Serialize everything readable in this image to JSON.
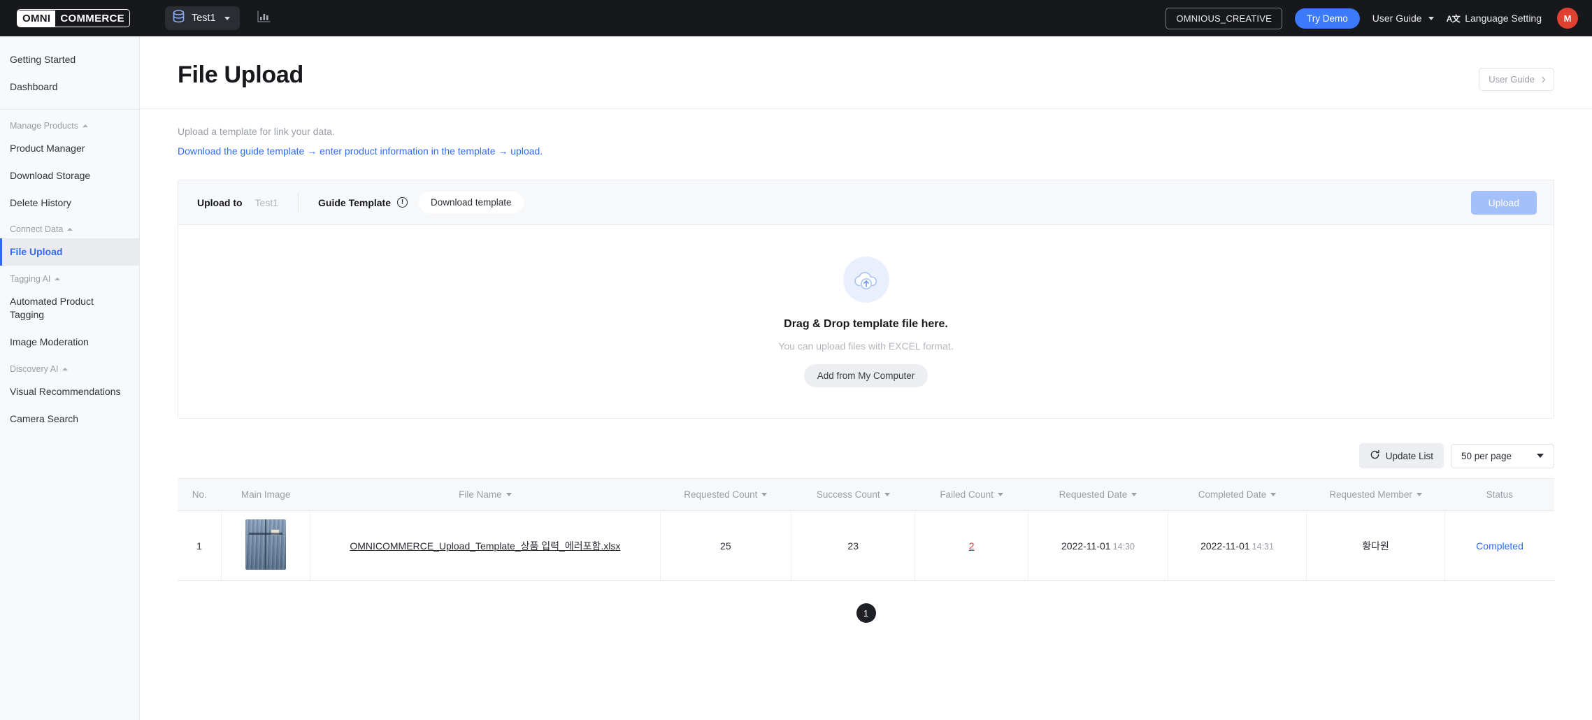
{
  "topbar": {
    "logo_left": "OMNI",
    "logo_right": "COMMERCE",
    "project_name": "Test1",
    "db_icon": "database-icon",
    "chart_icon": "bar-chart-icon",
    "org_name": "OMNIOUS_CREATIVE",
    "try_demo": "Try Demo",
    "user_guide": "User Guide",
    "language_glyph": "A文",
    "language_setting": "Language Setting",
    "avatar_initial": "M",
    "accent_blue": "#3b7bfb",
    "avatar_color": "#e0402f"
  },
  "sidebar": {
    "top_items": [
      {
        "label": "Getting Started"
      },
      {
        "label": "Dashboard"
      }
    ],
    "groups": [
      {
        "label": "Manage Products",
        "items": [
          {
            "label": "Product Manager",
            "active": false
          },
          {
            "label": "Download Storage",
            "active": false
          },
          {
            "label": "Delete History",
            "active": false
          }
        ]
      },
      {
        "label": "Connect Data",
        "items": [
          {
            "label": "File Upload",
            "active": true
          }
        ]
      },
      {
        "label": "Tagging AI",
        "items": [
          {
            "label": "Automated Product Tagging",
            "active": false
          },
          {
            "label": "Image Moderation",
            "active": false
          }
        ]
      },
      {
        "label": "Discovery AI",
        "items": [
          {
            "label": "Visual Recommendations",
            "active": false
          },
          {
            "label": "Camera Search",
            "active": false
          }
        ]
      }
    ]
  },
  "page": {
    "title": "File Upload",
    "user_guide_button": "User Guide",
    "description": "Upload a template for link your data.",
    "description_link": "Download the guide template → enter product information in the template → upload."
  },
  "upload_card": {
    "upload_to_label": "Upload to",
    "upload_to_value": "Test1",
    "guide_template_label": "Guide Template",
    "info_icon": "info-circle-icon",
    "download_template": "Download template",
    "upload_button": "Upload",
    "upload_button_disabled": true,
    "dropzone_icon": "cloud-upload-icon",
    "dropzone_title": "Drag & Drop template file here.",
    "dropzone_subtitle": "You can upload files with EXCEL format.",
    "dropzone_button": "Add from My Computer"
  },
  "table_controls": {
    "update_list": "Update List",
    "refresh_icon": "refresh-icon",
    "per_page": "50 per page"
  },
  "table": {
    "columns": [
      {
        "label": "No.",
        "sortable": false
      },
      {
        "label": "Main Image",
        "sortable": false
      },
      {
        "label": "File Name",
        "sortable": true
      },
      {
        "label": "Requested Count",
        "sortable": true
      },
      {
        "label": "Success Count",
        "sortable": true
      },
      {
        "label": "Failed Count",
        "sortable": true
      },
      {
        "label": "Requested Date",
        "sortable": true
      },
      {
        "label": "Completed Date",
        "sortable": true
      },
      {
        "label": "Requested Member",
        "sortable": true
      },
      {
        "label": "Status",
        "sortable": false
      }
    ],
    "rows": [
      {
        "no": "1",
        "image_alt": "denim-jacket-thumbnail",
        "file_name": "OMNICOMMERCE_Upload_Template_상품 입력_에러포함.xlsx",
        "requested_count": "25",
        "success_count": "23",
        "failed_count": "2",
        "requested_date": "2022-11-01",
        "requested_time": "14:30",
        "completed_date": "2022-11-01",
        "completed_time": "14:31",
        "requested_member": "황다원",
        "status": "Completed"
      }
    ]
  },
  "pagination": {
    "current_page": "1"
  }
}
